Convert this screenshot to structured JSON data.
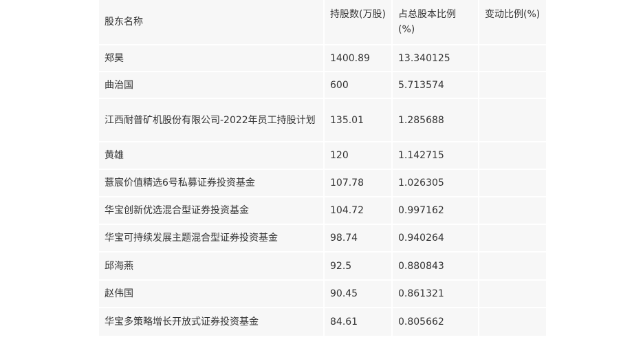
{
  "table": {
    "headers": [
      "股东名称",
      "持股数(万股)",
      "占总股本比例(%)",
      "变动比例(%)"
    ],
    "rows": [
      [
        "郑昊",
        "1400.89",
        "13.340125",
        ""
      ],
      [
        "曲治国",
        "600",
        "5.713574",
        ""
      ],
      [
        "江西耐普矿机股份有限公司-2022年员工持股计划",
        "135.01",
        "1.285688",
        ""
      ],
      [
        "黄雄",
        "120",
        "1.142715",
        ""
      ],
      [
        "薏宸价值精选6号私募证券投资基金",
        "107.78",
        "1.026305",
        ""
      ],
      [
        "华宝创新优选混合型证券投资基金",
        "104.72",
        "0.997162",
        ""
      ],
      [
        "华宝可持续发展主题混合型证券投资基金",
        "98.74",
        "0.940264",
        ""
      ],
      [
        "邱海燕",
        "92.5",
        "0.880843",
        ""
      ],
      [
        "赵伟国",
        "90.45",
        "0.861321",
        ""
      ],
      [
        "华宝多策略增长开放式证券投资基金",
        "84.61",
        "0.805662",
        ""
      ]
    ]
  }
}
